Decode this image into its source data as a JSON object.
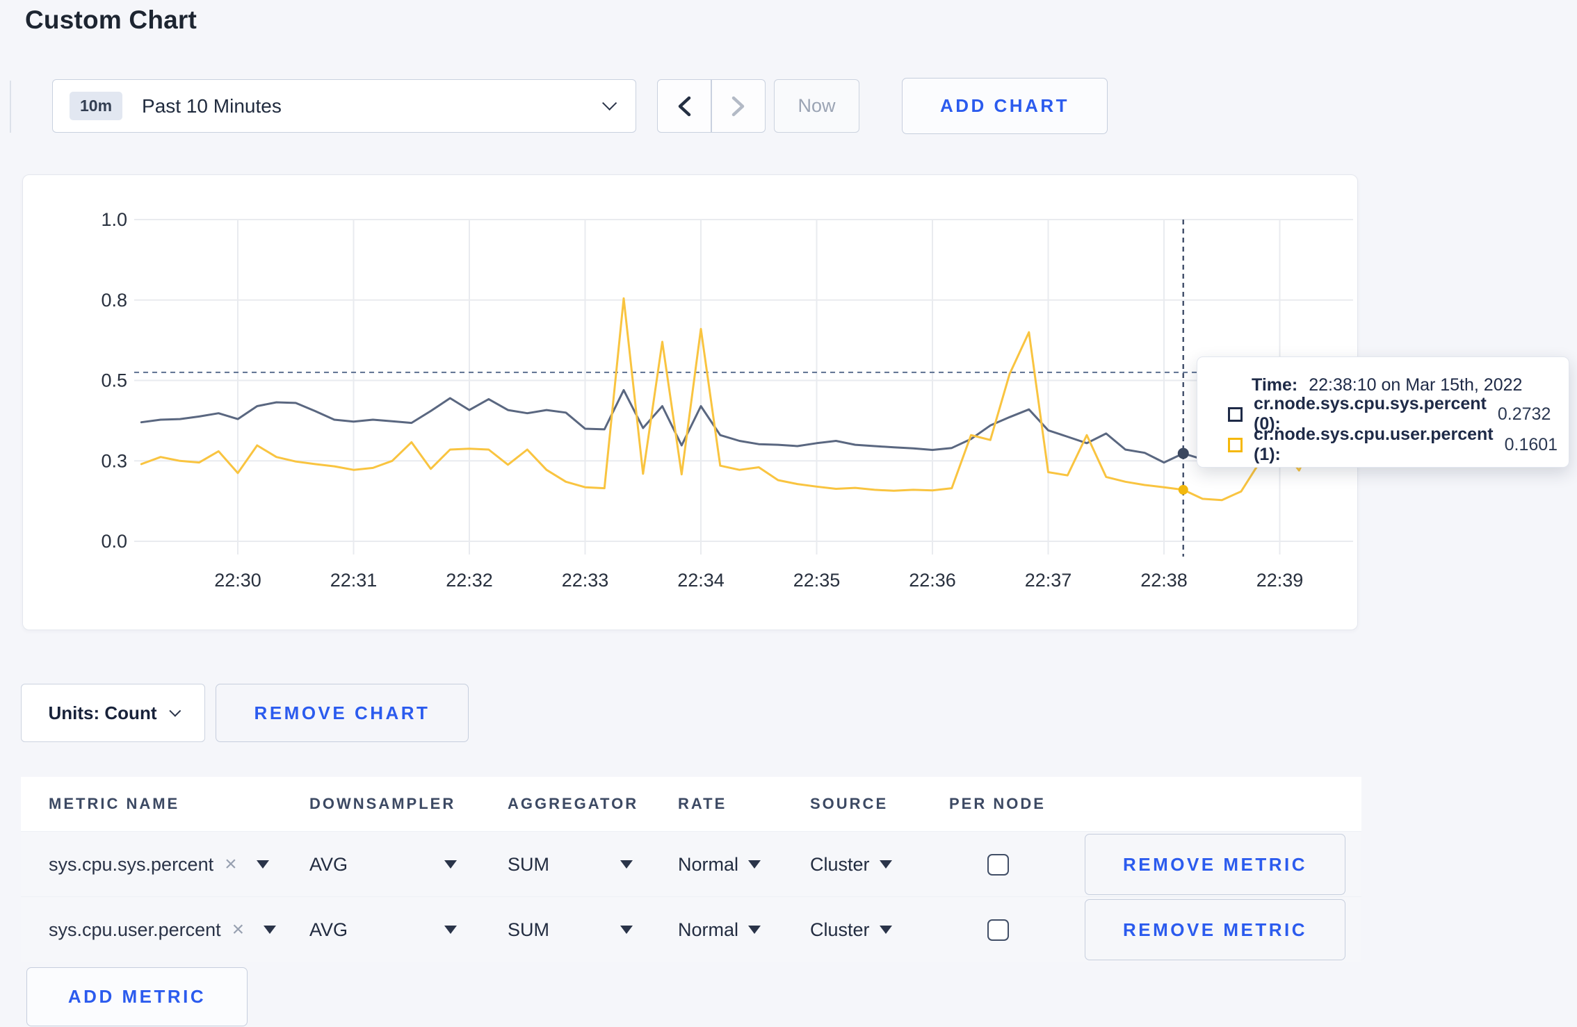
{
  "page": {
    "title": "Custom Chart"
  },
  "toolbar": {
    "timescale_badge": "10m",
    "timescale_label": "Past 10 Minutes",
    "now_label": "Now",
    "add_chart_label": "ADD CHART"
  },
  "chart_controls": {
    "units_label": "Units: Count",
    "remove_chart_label": "REMOVE CHART"
  },
  "tooltip": {
    "time_label": "Time:",
    "time_value": "22:38:10 on Mar 15th, 2022",
    "entries": [
      {
        "label": "cr.node.sys.cpu.sys.percent (0):",
        "value": "0.2732",
        "color": "#1e2a47"
      },
      {
        "label": "cr.node.sys.cpu.user.percent (1):",
        "value": "0.1601",
        "color": "#f5b80b"
      }
    ]
  },
  "table": {
    "headers": [
      "METRIC NAME",
      "DOWNSAMPLER",
      "AGGREGATOR",
      "RATE",
      "SOURCE",
      "PER NODE"
    ],
    "rows": [
      {
        "metric": "sys.cpu.sys.percent",
        "close": "×",
        "downsampler": "AVG",
        "aggregator": "SUM",
        "rate": "Normal",
        "source": "Cluster",
        "per_node_checked": false,
        "remove_label": "REMOVE METRIC"
      },
      {
        "metric": "sys.cpu.user.percent",
        "close": "×",
        "downsampler": "AVG",
        "aggregator": "SUM",
        "rate": "Normal",
        "source": "Cluster",
        "per_node_checked": false,
        "remove_label": "REMOVE METRIC"
      }
    ],
    "add_metric_label": "ADD METRIC"
  },
  "chart_data": {
    "type": "line",
    "title": "",
    "xlabel": "",
    "ylabel": "",
    "ylim": [
      0,
      1
    ],
    "grid": true,
    "legend": "none",
    "y_ticks": [
      {
        "pos": 0.0,
        "label": "0.0"
      },
      {
        "pos": 0.25,
        "label": "0.3"
      },
      {
        "pos": 0.5,
        "label": "0.5"
      },
      {
        "pos": 0.75,
        "label": "0.8"
      },
      {
        "pos": 1.0,
        "label": "1.0"
      }
    ],
    "x_ticks": [
      "22:30",
      "22:31",
      "22:32",
      "22:33",
      "22:34",
      "22:35",
      "22:36",
      "22:37",
      "22:38",
      "22:39"
    ],
    "axis_color": "#28303e",
    "grid_color": "#e9ebef",
    "crosshair": {
      "color": "#5c7090",
      "time_s": 490,
      "hline_pos": 0.525,
      "points": [
        {
          "series": 0,
          "value": 0.2732,
          "dot_color": "#3d4960",
          "r": 8
        },
        {
          "series": 1,
          "value": 0.1601,
          "dot_color": "#f2b80d",
          "r": 7
        }
      ]
    },
    "series": [
      {
        "name": "cr.node.sys.cpu.sys.percent",
        "color": "#5a6780",
        "points": [
          [
            -50,
            0.37
          ],
          [
            -40,
            0.378
          ],
          [
            -30,
            0.38
          ],
          [
            -20,
            0.388
          ],
          [
            -10,
            0.398
          ],
          [
            0,
            0.38
          ],
          [
            10,
            0.42
          ],
          [
            20,
            0.432
          ],
          [
            30,
            0.43
          ],
          [
            40,
            0.405
          ],
          [
            50,
            0.378
          ],
          [
            60,
            0.372
          ],
          [
            70,
            0.378
          ],
          [
            80,
            0.373
          ],
          [
            90,
            0.368
          ],
          [
            100,
            0.405
          ],
          [
            110,
            0.445
          ],
          [
            120,
            0.408
          ],
          [
            130,
            0.442
          ],
          [
            140,
            0.408
          ],
          [
            150,
            0.398
          ],
          [
            160,
            0.408
          ],
          [
            170,
            0.4
          ],
          [
            180,
            0.35
          ],
          [
            190,
            0.348
          ],
          [
            200,
            0.47
          ],
          [
            210,
            0.352
          ],
          [
            220,
            0.42
          ],
          [
            230,
            0.298
          ],
          [
            240,
            0.42
          ],
          [
            250,
            0.33
          ],
          [
            260,
            0.312
          ],
          [
            270,
            0.302
          ],
          [
            280,
            0.3
          ],
          [
            290,
            0.296
          ],
          [
            300,
            0.305
          ],
          [
            310,
            0.312
          ],
          [
            320,
            0.3
          ],
          [
            330,
            0.296
          ],
          [
            340,
            0.292
          ],
          [
            350,
            0.289
          ],
          [
            360,
            0.284
          ],
          [
            370,
            0.29
          ],
          [
            380,
            0.318
          ],
          [
            390,
            0.36
          ],
          [
            400,
            0.386
          ],
          [
            410,
            0.41
          ],
          [
            420,
            0.345
          ],
          [
            430,
            0.325
          ],
          [
            440,
            0.305
          ],
          [
            450,
            0.335
          ],
          [
            460,
            0.285
          ],
          [
            470,
            0.275
          ],
          [
            480,
            0.245
          ],
          [
            490,
            0.2732
          ],
          [
            500,
            0.255
          ],
          [
            510,
            0.275
          ],
          [
            520,
            0.29
          ],
          [
            530,
            0.3
          ],
          [
            540,
            0.3
          ]
        ]
      },
      {
        "name": "cr.node.sys.cpu.user.percent",
        "color": "#f9c440",
        "points": [
          [
            -50,
            0.24
          ],
          [
            -40,
            0.262
          ],
          [
            -30,
            0.25
          ],
          [
            -20,
            0.245
          ],
          [
            -10,
            0.28
          ],
          [
            0,
            0.212
          ],
          [
            10,
            0.298
          ],
          [
            20,
            0.262
          ],
          [
            30,
            0.248
          ],
          [
            40,
            0.24
          ],
          [
            50,
            0.233
          ],
          [
            60,
            0.222
          ],
          [
            70,
            0.228
          ],
          [
            80,
            0.25
          ],
          [
            90,
            0.308
          ],
          [
            100,
            0.225
          ],
          [
            110,
            0.285
          ],
          [
            120,
            0.288
          ],
          [
            130,
            0.285
          ],
          [
            140,
            0.238
          ],
          [
            150,
            0.285
          ],
          [
            160,
            0.222
          ],
          [
            170,
            0.185
          ],
          [
            180,
            0.168
          ],
          [
            190,
            0.165
          ],
          [
            200,
            0.755
          ],
          [
            210,
            0.21
          ],
          [
            220,
            0.62
          ],
          [
            230,
            0.208
          ],
          [
            240,
            0.66
          ],
          [
            250,
            0.235
          ],
          [
            260,
            0.222
          ],
          [
            270,
            0.23
          ],
          [
            280,
            0.19
          ],
          [
            290,
            0.178
          ],
          [
            300,
            0.17
          ],
          [
            310,
            0.163
          ],
          [
            320,
            0.166
          ],
          [
            330,
            0.16
          ],
          [
            340,
            0.157
          ],
          [
            350,
            0.16
          ],
          [
            360,
            0.158
          ],
          [
            370,
            0.165
          ],
          [
            380,
            0.33
          ],
          [
            390,
            0.315
          ],
          [
            400,
            0.52
          ],
          [
            410,
            0.65
          ],
          [
            420,
            0.215
          ],
          [
            430,
            0.205
          ],
          [
            440,
            0.33
          ],
          [
            450,
            0.2
          ],
          [
            460,
            0.185
          ],
          [
            470,
            0.175
          ],
          [
            480,
            0.168
          ],
          [
            490,
            0.1601
          ],
          [
            500,
            0.132
          ],
          [
            510,
            0.128
          ],
          [
            520,
            0.155
          ],
          [
            530,
            0.25
          ],
          [
            540,
            0.3
          ],
          [
            550,
            0.22
          ],
          [
            554,
            0.27
          ]
        ]
      }
    ]
  }
}
